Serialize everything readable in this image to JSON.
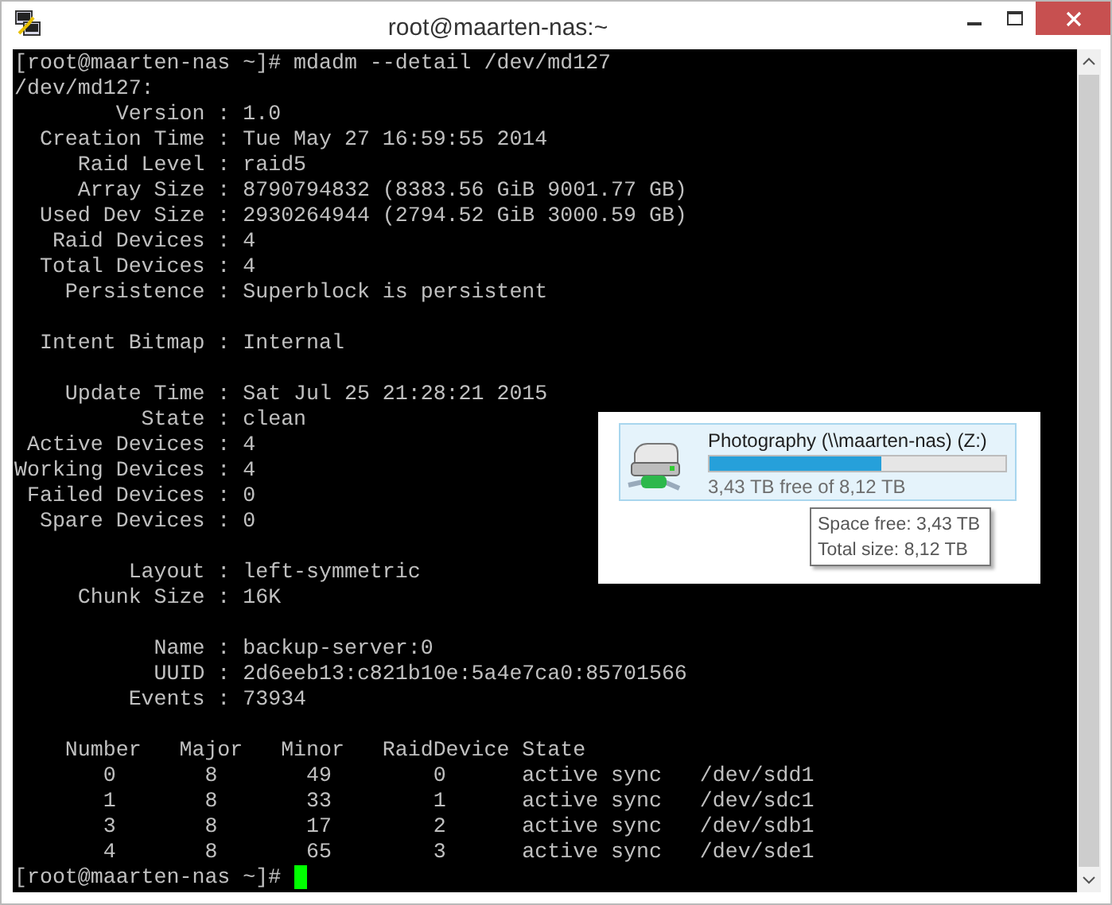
{
  "window": {
    "title": "root@maarten-nas:~"
  },
  "terminal": {
    "blocks": [
      [
        "[root@maarten-nas ~]# mdadm --detail /dev/md127",
        "/dev/md127:",
        "        Version : 1.0",
        "  Creation Time : Tue May 27 16:59:55 2014",
        "     Raid Level : raid5",
        "     Array Size : 8790794832 (8383.56 GiB 9001.77 GB)",
        "  Used Dev Size : 2930264944 (2794.52 GiB 3000.59 GB)",
        "   Raid Devices : 4",
        "  Total Devices : 4",
        "    Persistence : Superblock is persistent"
      ],
      [
        "  Intent Bitmap : Internal"
      ],
      [
        "    Update Time : Sat Jul 25 21:28:21 2015",
        "          State : clean",
        " Active Devices : 4",
        "Working Devices : 4",
        " Failed Devices : 0",
        "  Spare Devices : 0"
      ],
      [
        "         Layout : left-symmetric",
        "     Chunk Size : 16K"
      ],
      [
        "           Name : backup-server:0",
        "           UUID : 2d6eeb13:c821b10e:5a4e7ca0:85701566",
        "         Events : 73934"
      ],
      [
        "    Number   Major   Minor   RaidDevice State",
        "       0       8       49        0      active sync   /dev/sdd1",
        "       1       8       33        1      active sync   /dev/sdc1",
        "       3       8       17        2      active sync   /dev/sdb1",
        "       4       8       65        3      active sync   /dev/sde1"
      ]
    ],
    "prompt": "[root@maarten-nas ~]# "
  },
  "drive": {
    "name": "Photography (\\\\maarten-nas) (Z:)",
    "level": 0.578,
    "free_text": "3,43 TB free of 8,12 TB",
    "tooltip": [
      "Space free: 3,43 TB",
      "Total size: 8,12 TB"
    ]
  }
}
